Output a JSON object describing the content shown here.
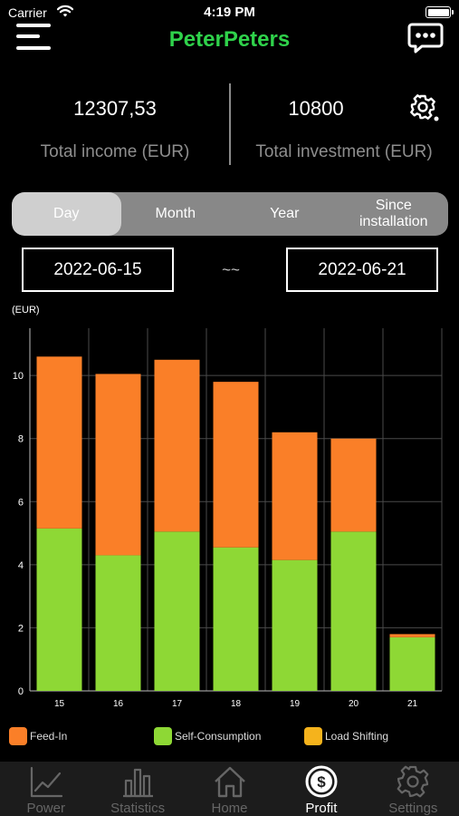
{
  "status_bar": {
    "carrier": "Carrier",
    "time": "4:19 PM"
  },
  "header": {
    "title": "PeterPeters"
  },
  "summary": {
    "total_income": "12307,53",
    "total_income_label": "Total income (EUR)",
    "total_investment": "10800",
    "total_investment_label": "Total investment (EUR)"
  },
  "period_tabs": [
    {
      "label": "Day",
      "active": true
    },
    {
      "label": "Month",
      "active": false
    },
    {
      "label": "Year",
      "active": false
    },
    {
      "label": "Since installation",
      "active": false
    }
  ],
  "date_range": {
    "start": "2022-06-15",
    "separator": "~~",
    "end": "2022-06-21"
  },
  "colors": {
    "feed_in": "#fa7f28",
    "self_consumption": "#8ed835",
    "load_shifting": "#f5b31c",
    "accent": "#2fd24b"
  },
  "chart_data": {
    "type": "bar",
    "stacked": true,
    "unit_label": "(EUR)",
    "categories": [
      "15",
      "16",
      "17",
      "18",
      "19",
      "20",
      "21"
    ],
    "series": [
      {
        "name": "Self-Consumption",
        "color": "#8ed835",
        "values": [
          5.15,
          4.3,
          5.05,
          4.55,
          4.15,
          5.05,
          1.7
        ]
      },
      {
        "name": "Feed-In",
        "color": "#fa7f28",
        "values": [
          5.45,
          5.75,
          5.45,
          5.25,
          4.05,
          2.95,
          0.1
        ]
      },
      {
        "name": "Load Shifting",
        "color": "#f5b31c",
        "values": [
          0,
          0,
          0,
          0,
          0,
          0,
          0
        ]
      }
    ],
    "y_ticks": [
      "0",
      "2",
      "4",
      "6",
      "8",
      "10"
    ],
    "ylim": [
      0,
      11.5
    ],
    "grid": true
  },
  "legend": [
    {
      "label": "Feed-In",
      "color": "#fa7f28"
    },
    {
      "label": "Self-Consumption",
      "color": "#8ed835"
    },
    {
      "label": "Load Shifting",
      "color": "#f5b31c"
    }
  ],
  "tabbar": [
    {
      "label": "Power",
      "icon": "line-chart-icon",
      "active": false
    },
    {
      "label": "Statistics",
      "icon": "bar-chart-icon",
      "active": false
    },
    {
      "label": "Home",
      "icon": "home-icon",
      "active": false
    },
    {
      "label": "Profit",
      "icon": "dollar-icon",
      "active": true
    },
    {
      "label": "Settings",
      "icon": "gear-icon",
      "active": false
    }
  ]
}
